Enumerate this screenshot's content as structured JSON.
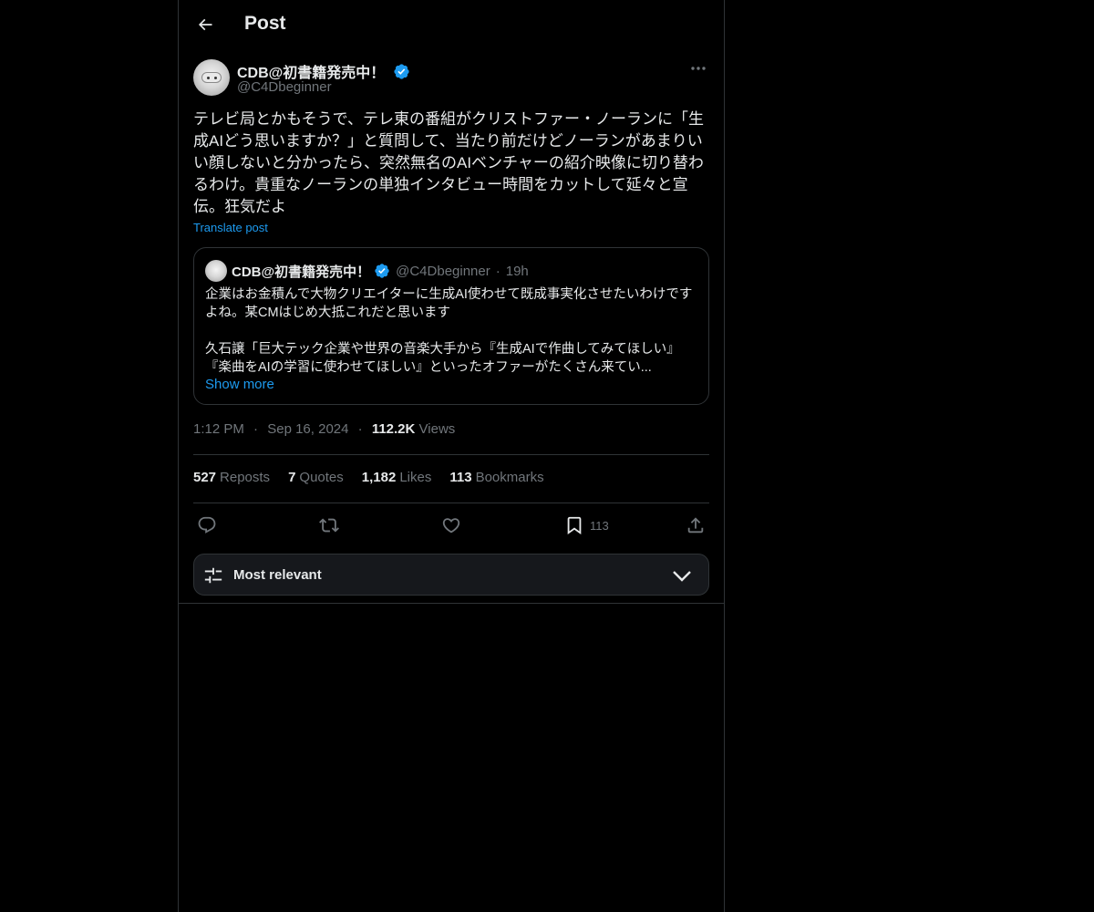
{
  "header": {
    "title": "Post"
  },
  "post": {
    "author_name": "CDB@初書籍発売中！",
    "author_handle": "@C4Dbeginner",
    "text": "テレビ局とかもそうで、テレ東の番組がクリストファー・ノーランに「生成AIどう思いますか？」と質問して、当たり前だけどノーランがあまりいい顔しないと分かったら、突然無名のAIベンチャーの紹介映像に切り替わるわけ。貴重なノーランの単独インタビュー時間をカットして延々と宣伝。狂気だよ",
    "translate_label": "Translate post",
    "time": "1:12 PM",
    "date": "Sep 16, 2024",
    "separator": "·",
    "views_count": "112.2K",
    "views_label": "Views"
  },
  "quote": {
    "author_name": "CDB@初書籍発売中！",
    "author_handle": "@C4Dbeginner",
    "separator": "·",
    "time": "19h",
    "text": "企業はお金積んで大物クリエイターに生成AI使わせて既成事実化させたいわけですよね。某CMはじめ大抵これだと思います\n\n久石譲「巨大テック企業や世界の音楽大手から『生成AIで作曲してみてほしい』『楽曲をAIの学習に使わせてほしい』といったオファーがたくさん来てい...",
    "show_more_label": "Show more"
  },
  "stats": {
    "reposts_count": "527",
    "reposts_label": "Reposts",
    "quotes_count": "7",
    "quotes_label": "Quotes",
    "likes_count": "1,182",
    "likes_label": "Likes",
    "bookmarks_count": "113",
    "bookmarks_label": "Bookmarks"
  },
  "actions": {
    "reply_icon": "reply-icon",
    "repost_icon": "repost-icon",
    "like_icon": "heart-icon",
    "bookmark_icon": "bookmark-icon",
    "bookmark_count": "113",
    "share_icon": "share-icon"
  },
  "sort": {
    "label": "Most relevant"
  },
  "colors": {
    "background": "#000000",
    "text": "#e7e9ea",
    "secondary": "#71767b",
    "accent": "#1d9bf0",
    "border": "#2f3336"
  }
}
